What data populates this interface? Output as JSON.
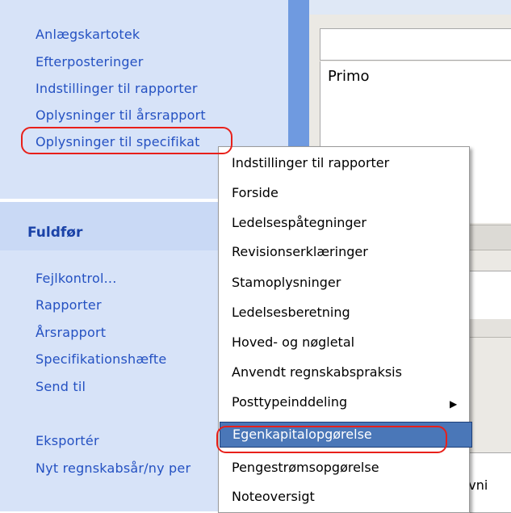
{
  "sidebar": {
    "items_top": [
      "Anlægskartotek",
      "Efterposteringer",
      "Indstillinger til rapporter",
      "Oplysninger til årsrapport",
      "Oplysninger til specifikat"
    ],
    "section_label": "Fuldfør",
    "items_bottom": [
      "Fejlkontrol...",
      "Rapporter",
      "Årsrapport",
      "Specifikationshæfte",
      "Send til",
      "Eksportér",
      "Nyt regnskabsår/ny per"
    ]
  },
  "main": {
    "primo_label": "Primo",
    "bottom_partial_text": "krivni"
  },
  "context_menu": {
    "items": [
      "Indstillinger til rapporter",
      "Forside",
      "Ledelsespåtegninger",
      "Revisionserklæringer",
      "Stamoplysninger",
      "Ledelsesberetning",
      "Hoved- og nøgletal",
      "Anvendt regnskabspraksis",
      "Posttypeinddeling",
      "Egenkapitalopgørelse",
      "Pengestrømsopgørelse",
      "Noteoversigt"
    ],
    "submenu_item": "Posttypeinddeling",
    "highlighted_item": "Egenkapitalopgørelse",
    "submenu_icon": "chevron-right-icon"
  },
  "colors": {
    "sidebar_bg": "#d7e3f8",
    "sidebar_text": "#2451c2",
    "highlight_bg": "#4a77b8",
    "annotation_red": "#e8201a"
  }
}
